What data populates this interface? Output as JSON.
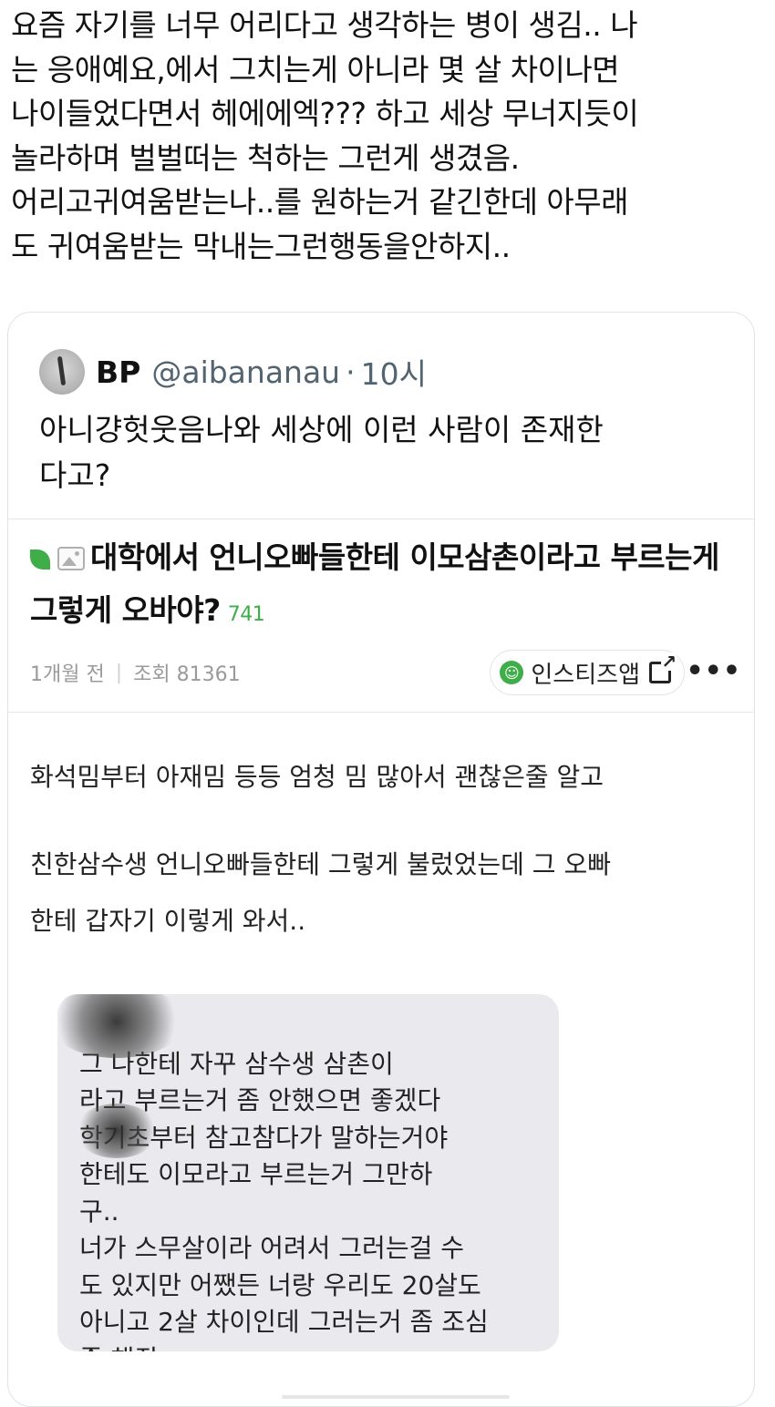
{
  "tweet": {
    "text": "요즘 자기를 너무 어리다고 생각하는 병이 생김.. 나\n는 응애예요,에서 그치는게 아니라 몇 살 차이나면\n나이들었다면서 헤에에엑??? 하고 세상 무너지듯이\n놀라하며 벌벌떠는 척하는 그런게 생겼음.\n어리고귀여움받는나..를 원하는거 같긴한데 아무래\n도 귀여움받는 막내는그런행동을안하지.."
  },
  "quote": {
    "name": "BP",
    "handle": "@aibananau",
    "dot": "·",
    "time": "10시",
    "text": "아니걍헛웃음나와 세상에 이런 사람이 존재한\n다고?"
  },
  "article": {
    "title": "대학에서 언니오빠들한테 이모삼촌이라고 부르는게 그렇게 오바야?",
    "comment_count": "741",
    "age": "1개월 전",
    "separator": "|",
    "views": "조회 81361",
    "share_label": "인스티즈앱",
    "more": "•••",
    "paragraph1": "화석밈부터 아재밈 등등 엄청 밈 많아서 괜찮은줄 알고",
    "paragraph2": "친한삼수생  언니오빠들한테 그렇게 불렀었는데 그 오빠",
    "paragraph3": "한테 갑자기 이렇게 와서..",
    "chat": "        그 나한테 자꾸 삼수생 삼촌이\n라고 부르는거 좀 안했으면 좋겠다\n학기초부터 참고참다가 말하는거야\n      한테도 이모라고 부르는거 그만하\n구..\n너가 스무살이라 어려서 그러는걸 수\n도 있지만 어쨌든 너랑 우리도 20살도\n아니고 2살 차이인데 그러는거 좀 조심\n좀 해줘"
  },
  "colors": {
    "accent_green": "#3fae49",
    "muted_text": "#536471",
    "bubble_bg": "#eaeaee"
  },
  "icons": [
    "leaf-icon",
    "image-icon",
    "smile-icon",
    "external-link-icon",
    "more-icon",
    "avatar"
  ]
}
